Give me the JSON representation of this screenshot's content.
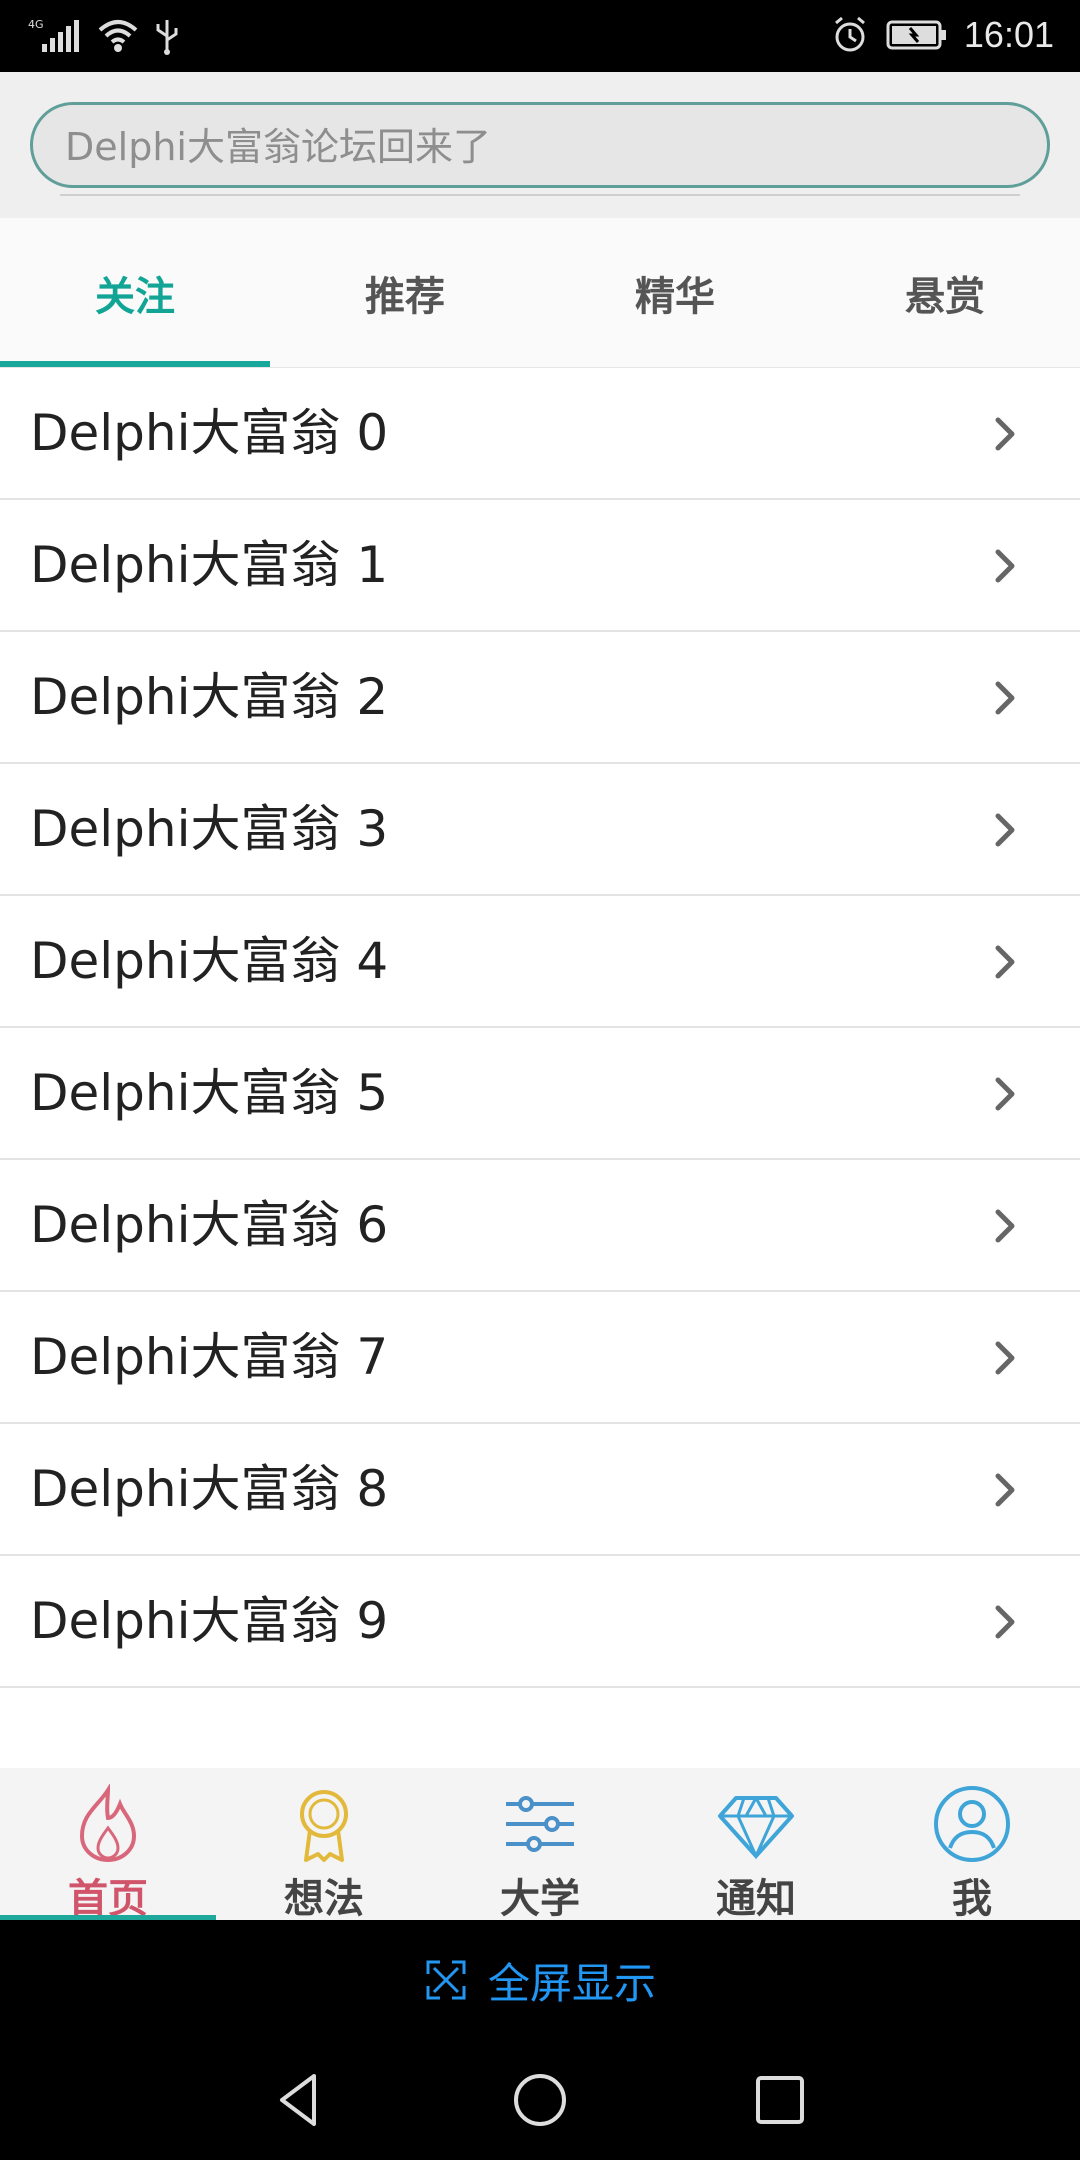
{
  "status_bar": {
    "network": "4G",
    "time": "16:01"
  },
  "search": {
    "placeholder": "Delphi大富翁论坛回来了"
  },
  "tabs": [
    {
      "label": "关注",
      "active": true
    },
    {
      "label": "推荐",
      "active": false
    },
    {
      "label": "精华",
      "active": false
    },
    {
      "label": "悬赏",
      "active": false
    }
  ],
  "list": {
    "items": [
      {
        "label": "Delphi大富翁 0"
      },
      {
        "label": "Delphi大富翁 1"
      },
      {
        "label": "Delphi大富翁 2"
      },
      {
        "label": "Delphi大富翁 3"
      },
      {
        "label": "Delphi大富翁 4"
      },
      {
        "label": "Delphi大富翁 5"
      },
      {
        "label": "Delphi大富翁 6"
      },
      {
        "label": "Delphi大富翁 7"
      },
      {
        "label": "Delphi大富翁 8"
      },
      {
        "label": "Delphi大富翁 9"
      }
    ]
  },
  "bottom_nav": [
    {
      "label": "首页",
      "icon": "flame-icon",
      "active": true
    },
    {
      "label": "想法",
      "icon": "medal-icon",
      "active": false
    },
    {
      "label": "大学",
      "icon": "sliders-icon",
      "active": false
    },
    {
      "label": "通知",
      "icon": "diamond-icon",
      "active": false
    },
    {
      "label": "我",
      "icon": "user-icon",
      "active": false
    }
  ],
  "fullscreen": {
    "label": "全屏显示"
  },
  "colors": {
    "accent": "#17a89b",
    "active_nav": "#d0556b",
    "fullscreen_blue": "#2196f3"
  }
}
